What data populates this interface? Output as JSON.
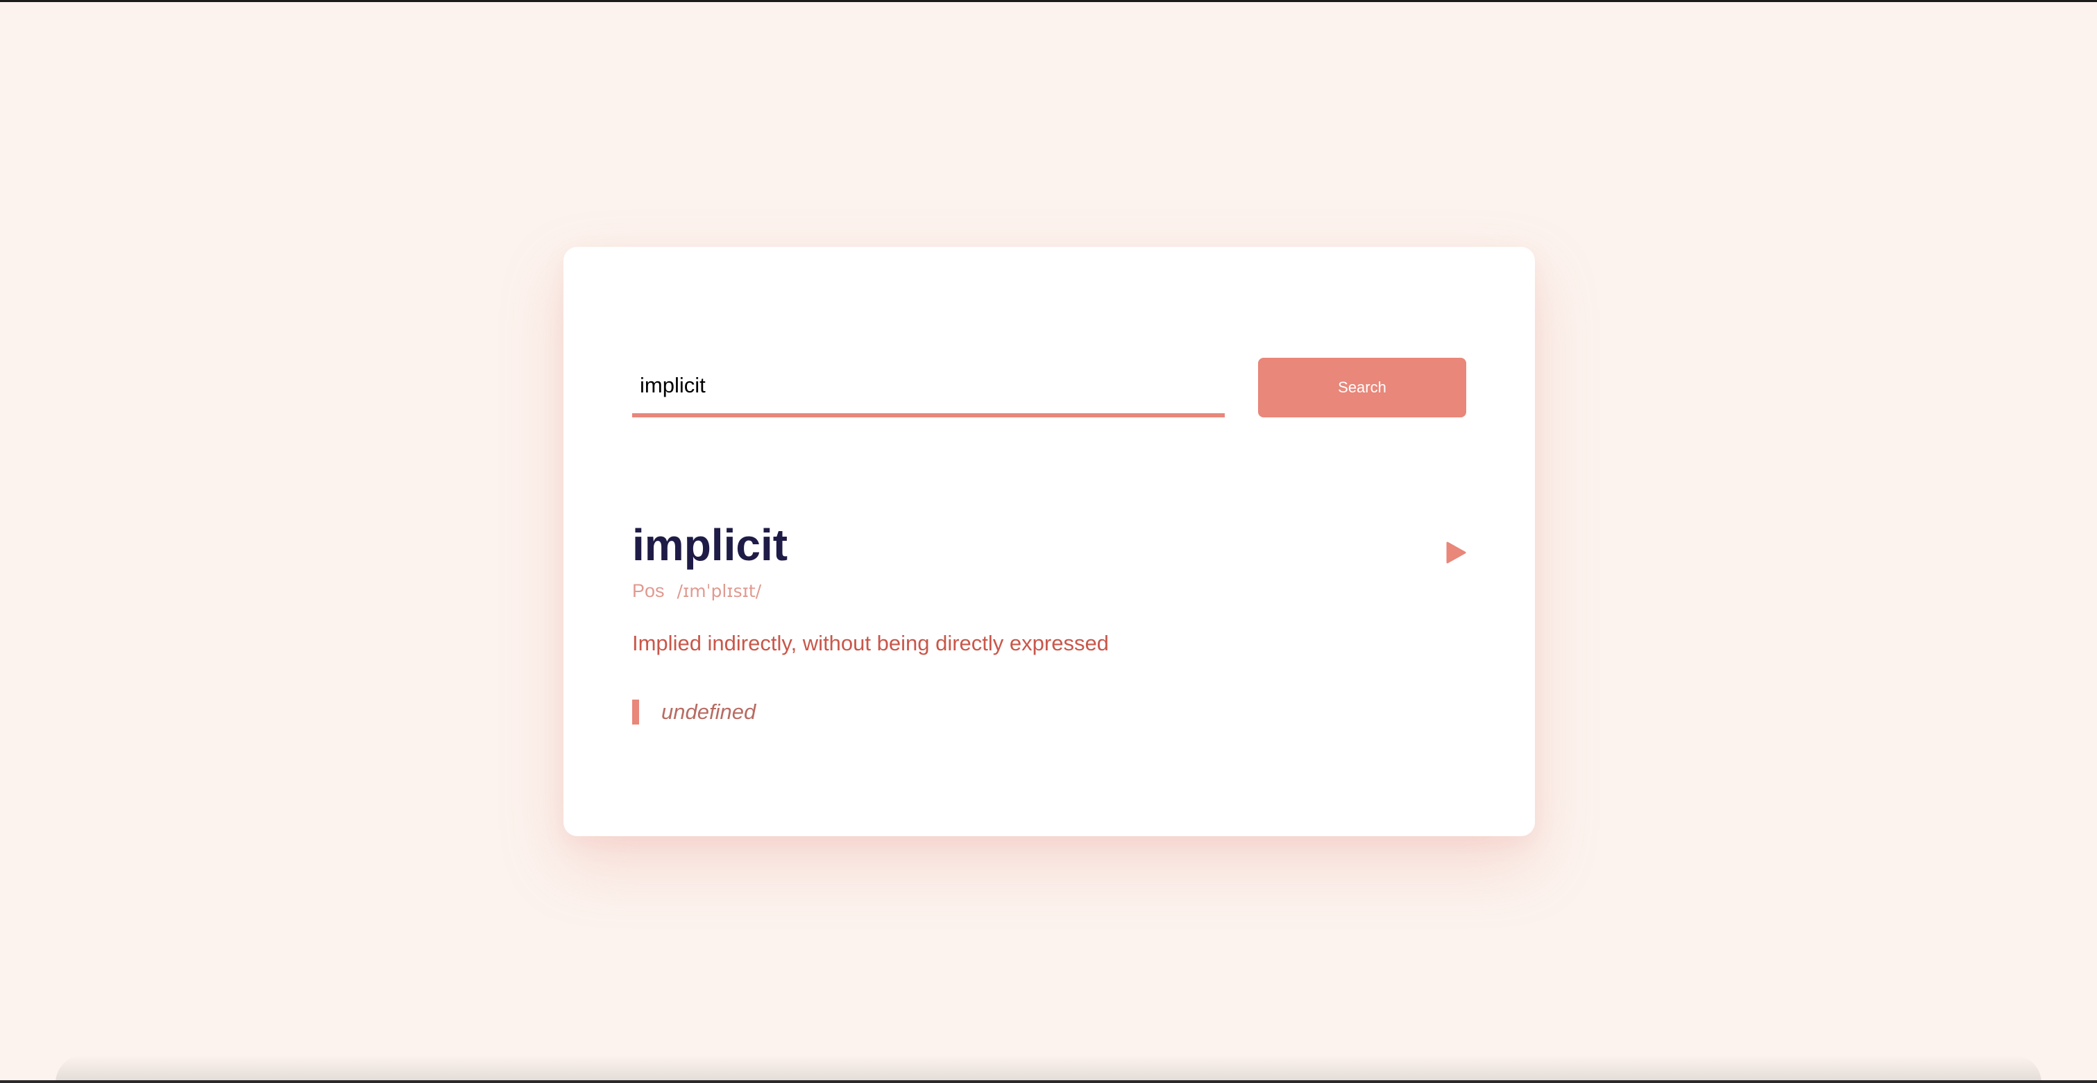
{
  "search": {
    "value": "implicit",
    "button_label": "Search"
  },
  "entry": {
    "word": "implicit",
    "part_of_speech": "Pos",
    "phonetic": "/ɪmˈplɪsɪt/",
    "definition": "Implied indirectly, without being directly expressed",
    "example": "undefined"
  },
  "icons": {
    "play": "play-icon"
  },
  "colors": {
    "background": "#fcf3ee",
    "accent": "#e8877a",
    "word": "#1f1b47",
    "definition": "#c9574a"
  }
}
